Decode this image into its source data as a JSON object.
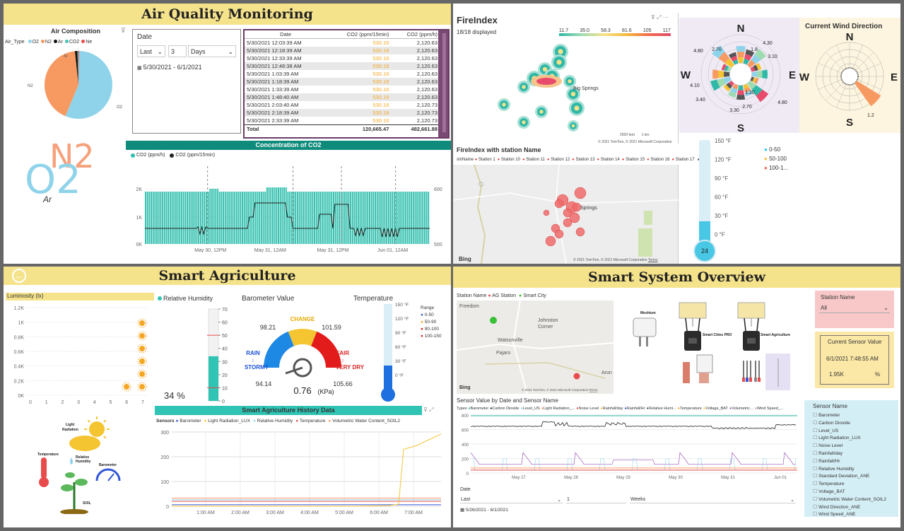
{
  "aq": {
    "title": "Air Quality Monitoring",
    "composition": {
      "title": "Air Composition",
      "legend_title": "Air_Type",
      "legend": [
        {
          "label": "O2",
          "color": "#8fd3ea"
        },
        {
          "label": "N2",
          "color": "#f79a62"
        },
        {
          "label": "Ar",
          "color": "#111111"
        },
        {
          "label": "CO2",
          "color": "#45c4b4"
        },
        {
          "label": "Ne",
          "color": "#e84b4b"
        }
      ],
      "label_o2": "O2",
      "label_n2": "N2",
      "label_ar": "Ar",
      "slices": [
        {
          "name": "O2",
          "value": 56,
          "color": "#8fd3ea"
        },
        {
          "name": "N2",
          "value": 42,
          "color": "#f79a62"
        },
        {
          "name": "Ar",
          "value": 1.2,
          "color": "#111111"
        },
        {
          "name": "CO2",
          "value": 0.4,
          "color": "#45c4b4"
        },
        {
          "name": "Ne",
          "value": 0.4,
          "color": "#e84b4b"
        }
      ]
    },
    "logo": {
      "n2": "N2",
      "o2": "O2",
      "ar": "Ar"
    },
    "date": {
      "title": "Date",
      "mode": "Last",
      "count": "3",
      "unit": "Days",
      "range": "5/30/2021 - 6/1/2021"
    },
    "table": {
      "headers": [
        "Date",
        "CO2 (ppm/15min)",
        "CO2 (ppm/h)"
      ],
      "rows": [
        [
          "5/30/2021 12:03:39 AM",
          "530.16",
          "2,120.63"
        ],
        [
          "5/30/2021 12:18:39 AM",
          "530.16",
          "2,120.63"
        ],
        [
          "5/30/2021 12:33:39 AM",
          "530.16",
          "2,120.63"
        ],
        [
          "5/30/2021 12:48:38 AM",
          "530.16",
          "2,120.63"
        ],
        [
          "5/30/2021 1:03:39 AM",
          "530.16",
          "2,120.63"
        ],
        [
          "5/30/2021 1:18:39 AM",
          "530.16",
          "2,120.63"
        ],
        [
          "5/30/2021 1:33:39 AM",
          "530.16",
          "2,120.63"
        ],
        [
          "5/30/2021 1:48:40 AM",
          "530.16",
          "2,120.63"
        ],
        [
          "5/30/2021 2:03:40 AM",
          "530.16",
          "2,120.73"
        ],
        [
          "5/30/2021 2:18:39 AM",
          "530.16",
          "2,120.73"
        ],
        [
          "5/30/2021 2:33:39 AM",
          "530.16",
          "2,120.73"
        ]
      ],
      "total_label": "Total",
      "total_15": "120,665.47",
      "total_h": "482,661.88"
    },
    "co2": {
      "title": "Concentration of CO2",
      "legend": [
        "CO2 (ppm/h)",
        "CO2 (ppm/15min)"
      ],
      "y_left": [
        "2K",
        "1K",
        "0K"
      ],
      "y_right": [
        "600",
        "500"
      ],
      "x": [
        "May 30, 12PM",
        "May 31, 12AM",
        "May 31, 12PM",
        "Jun 01, 12AM"
      ]
    }
  },
  "fire": {
    "title": "FireIndex",
    "displayed": "18/18 displayed",
    "scale": [
      "11.7",
      "35.0",
      "58.3",
      "81.6",
      "105",
      "117"
    ],
    "place": "Big Springs",
    "scalebar": "2500 feet",
    "scalebar2": "1 km",
    "copy": "© 2021 TomTom, © 2021 Microsoft Corporation",
    "map2_title": "FireIndex with station Name",
    "legend_field": "stnName",
    "stations": [
      "Station 1",
      "Station 10",
      "Station 11",
      "Station 12",
      "Station 13",
      "Station 14",
      "Station 15",
      "Station 16",
      "Station 17"
    ],
    "place2": "Springs",
    "bing": "Bing",
    "copy2": "© 2021 TomTom, © 2021 Microsoft Corporation",
    "terms": "Terms"
  },
  "wind": {
    "n": "N",
    "s": "S",
    "e": "E",
    "w": "W",
    "values": [
      "4.80",
      "2.70",
      "4.30",
      "3.10",
      "1.8",
      "4.10",
      "3.40",
      "3.30",
      "2.70",
      "4.80",
      "1.20"
    ],
    "current_title": "Current Wind Direction",
    "cur_value": "1.2",
    "cn": "N",
    "cs": "S",
    "ce": "E",
    "cw": "W"
  },
  "therm": {
    "ticks": [
      "150 °F",
      "120 °F",
      "90 °F",
      "60 °F",
      "30 °F",
      "0 °F"
    ],
    "value": "24",
    "legend": [
      "0-50",
      "50-100",
      "100-1..."
    ],
    "legend_colors": [
      "#2fc4e8",
      "#f5b93b",
      "#f26b4a"
    ]
  },
  "agri": {
    "title": "Smart Agriculture",
    "lum": {
      "title": "Luminosity (lx)",
      "y": [
        "1.2K",
        "1K",
        "0.8K",
        "0.6K",
        "0.4K",
        "0.2K",
        "0K"
      ],
      "x": [
        "0",
        "1",
        "2",
        "3",
        "4",
        "5",
        "6",
        "7"
      ]
    },
    "icons": {
      "light": "Light Radiation",
      "temp": "Temperature",
      "humid": "Relative Humidity",
      "baro": "Barometer",
      "soil": "SOIL"
    },
    "humidity": {
      "title": "Relative Humidity",
      "ticks": [
        "70",
        "60",
        "50",
        "40",
        "30",
        "20",
        "10",
        "0"
      ],
      "value": "34 %"
    },
    "baro": {
      "title": "Barometer Value",
      "change": "CHANGE",
      "v1": "98.21",
      "v2": "101.59",
      "rain": "RAIN",
      "stormy": "STORMY",
      "fair": "FAIR",
      "verydry": "VERY DRY",
      "min": "94.14",
      "max": "105.66",
      "value": "0.76",
      "unit": "(KPa)"
    },
    "temp": {
      "title": "Temperature",
      "ticks": [
        "150 °F",
        "120 °F",
        "90 °F",
        "60 °F",
        "30 °F",
        "0 °F"
      ],
      "range_title": "Range",
      "ranges": [
        "0-50",
        "50-90",
        "90-100",
        "100-150"
      ],
      "range_colors": [
        "#2f56d8",
        "#f5a623",
        "#d92626",
        "#d92626"
      ]
    },
    "history": {
      "title": "Smart Agriculture History Data",
      "legend_title": "Sensors",
      "legend": [
        {
          "label": "Barometer",
          "color": "#2f56d8"
        },
        {
          "label": "Light Radiation_LUX",
          "color": "#f5c431"
        },
        {
          "label": "Relative Humidity",
          "color": "#8fd3ea"
        },
        {
          "label": "Temperature",
          "color": "#e84b4b"
        },
        {
          "label": "Volumetric Water Content_SOIL2",
          "color": "#f79a62"
        }
      ],
      "y": [
        "300",
        "200",
        "100",
        "0"
      ],
      "x": [
        "1:00 AM",
        "2:00 AM",
        "3:00 AM",
        "4:00 AM",
        "5:00 AM",
        "6:00 AM",
        "7:00 AM"
      ]
    }
  },
  "sys": {
    "title": "Smart System Overview",
    "map_legend_field": "Station Name",
    "map_legend": [
      {
        "label": "AG Station",
        "color": "#e84b4b"
      },
      {
        "label": "Smart City",
        "color": "#3ac13a"
      }
    ],
    "places": [
      "Freedom",
      "Johnston Corner",
      "Watsonville",
      "Pajaro",
      "Aron"
    ],
    "bing": "Bing",
    "copy": "© 2021 TomTom, © 2021 Microsoft Corporation",
    "terms": "Terms",
    "devices": [
      "Meshium",
      "Smart Cities PRO",
      "Smart Agriculture"
    ],
    "station_filter": {
      "title": "Station Name",
      "value": "All"
    },
    "sensor_card": {
      "title": "Current Sensor Value",
      "date": "6/1/2021 7:48:55 AM",
      "value": "1.95K",
      "unit": "%"
    },
    "line": {
      "title": "Sensor Value by Date and Sensor Name",
      "types_label": "Types",
      "types": [
        {
          "label": "Barometer",
          "color": "#2fb8a8"
        },
        {
          "label": "Carbon Dioxide",
          "color": "#222222"
        },
        {
          "label": "Level_US",
          "color": "#8fd3ea"
        },
        {
          "label": "Light Radiation_...",
          "color": "#f79a62"
        },
        {
          "label": "Noise Level",
          "color": "#e84b4b"
        },
        {
          "label": "Rainfall/day",
          "color": "#f5c431"
        },
        {
          "label": "Rainfall/Hr",
          "color": "#2f56d8"
        },
        {
          "label": "Relative Humi...",
          "color": "#555555"
        },
        {
          "label": "Temperature",
          "color": "#f5a623"
        },
        {
          "label": "Voltage_BAT",
          "color": "#f5c431"
        },
        {
          "label": "Volumetric...",
          "color": "#9b59b6"
        },
        {
          "label": "Wind Speed_...",
          "color": "#d3a0d3"
        }
      ],
      "y": [
        "800",
        "600",
        "400",
        "200",
        "0"
      ],
      "x": [
        "May 27",
        "May 28",
        "May 29",
        "May 30",
        "May 31",
        "Jun 01"
      ]
    },
    "date": {
      "title": "Date",
      "mode": "Last",
      "count": "1",
      "unit": "Weeks",
      "range": "5/26/2021 - 6/1/2021"
    },
    "sensor_list": {
      "title": "Sensor Name",
      "items": [
        "Barometer",
        "Carbon Dioxide",
        "Level_US",
        "Light Radiation_LUX",
        "Noise Level",
        "Rainfall/day",
        "Rainfall/Hr",
        "Relative Humidity",
        "Standard Deviation_ANE",
        "Temperature",
        "Voltage_BAT",
        "Volumetric Water Content_SOIL2",
        "Wind Direction_ANE",
        "Wind Speed_ANE"
      ]
    }
  }
}
